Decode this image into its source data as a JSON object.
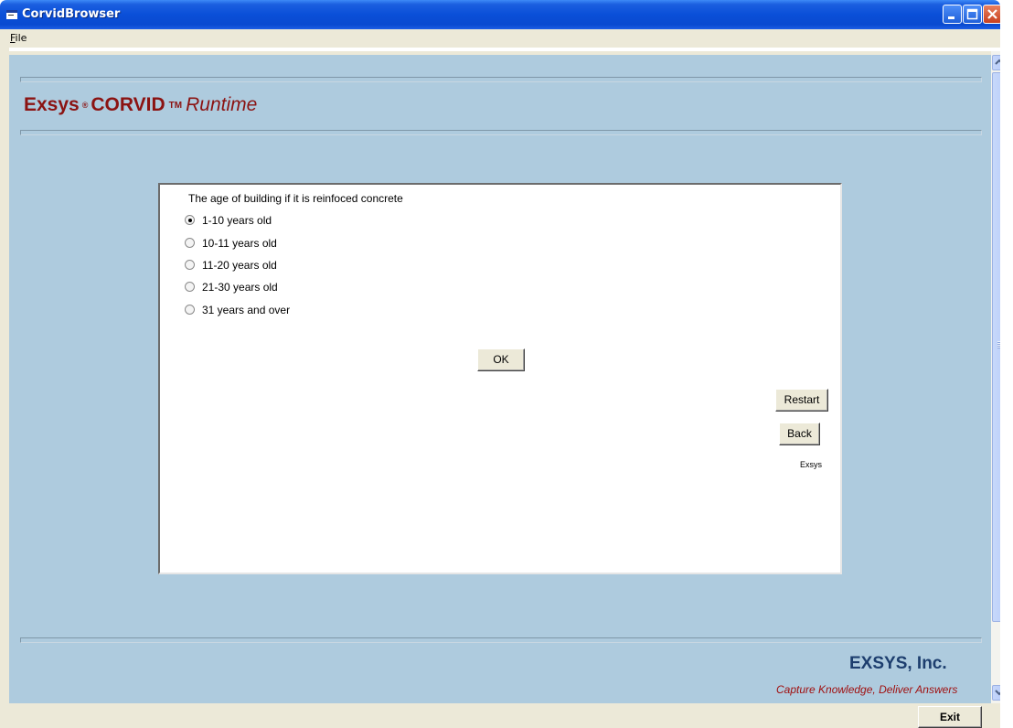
{
  "window": {
    "title": "CorvidBrowser"
  },
  "menu": {
    "file": "File"
  },
  "header": {
    "brand": "Exsys",
    "registered": "®",
    "product": "CORVID",
    "trademark": "TM",
    "runtime": "Runtime"
  },
  "question": {
    "prompt": "The age of building if it is reinfoced concrete",
    "options": [
      {
        "label": "1-10 years old",
        "selected": true
      },
      {
        "label": "10-11 years old",
        "selected": false
      },
      {
        "label": "11-20 years old",
        "selected": false
      },
      {
        "label": "21-30 years old",
        "selected": false
      },
      {
        "label": "31 years and over",
        "selected": false
      }
    ],
    "ok_label": "OK"
  },
  "nav": {
    "restart_label": "Restart",
    "back_label": "Back",
    "credit": "Exsys"
  },
  "footer": {
    "company": "EXSYS, Inc.",
    "tagline": "Capture Knowledge, Deliver Answers"
  },
  "statusbar": {
    "exit_label": "Exit"
  },
  "colors": {
    "titlebar": "#0a4fd8",
    "background": "#aecbde",
    "brand": "#8b1312",
    "company": "#1d3e6e",
    "tagline": "#a01010"
  }
}
